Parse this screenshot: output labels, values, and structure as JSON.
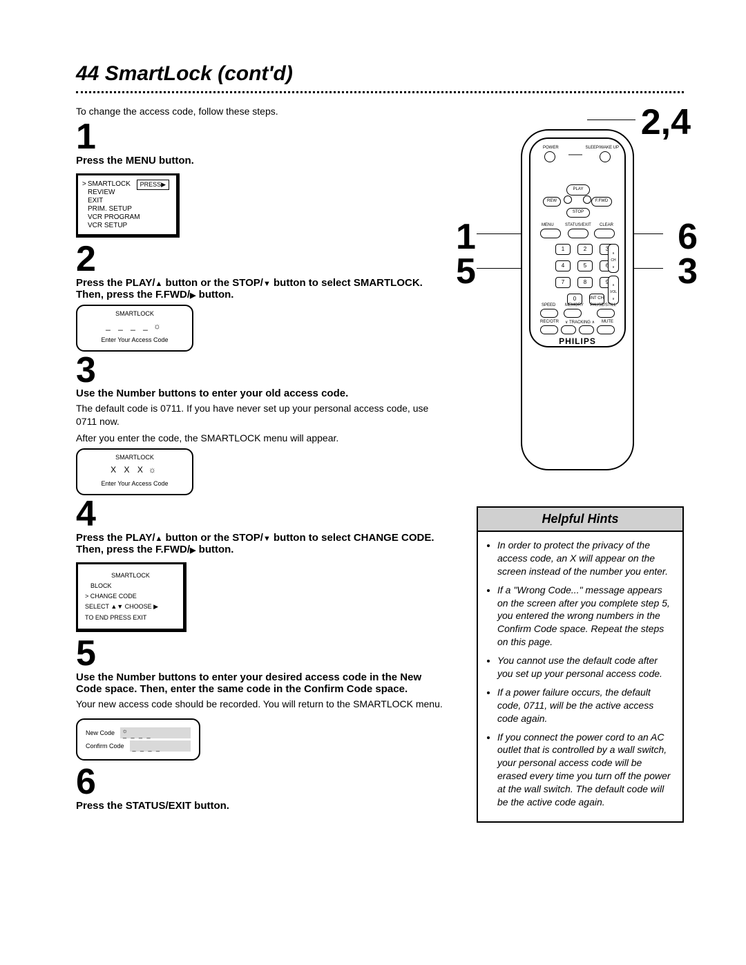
{
  "page": {
    "number": "44",
    "title": "SmartLock (cont'd)"
  },
  "intro": "To change the access code, follow these steps.",
  "steps": {
    "s1": {
      "num": "1",
      "bold": "Press the MENU button.",
      "menu": {
        "l1": "SMARTLOCK",
        "l2": "REVIEW",
        "l3": "EXIT",
        "l4": "PRIM. SETUP",
        "l5": "VCR PROGRAM",
        "l6": "VCR SETUP",
        "press": "PRESS▶"
      }
    },
    "s2": {
      "num": "2",
      "bold_a": "Press the PLAY/",
      "bold_b": " button or the STOP/",
      "bold_c": " button to select SMARTLOCK. Then, press the F.FWD/",
      "bold_d": " button.",
      "tv": {
        "title": "SMARTLOCK",
        "enter": "Enter Your Access Code"
      }
    },
    "s3": {
      "num": "3",
      "bold": "Use the Number buttons to enter your old access code.",
      "body1": "The default code is 0711. If you have never set up your personal access code, use 0711 now.",
      "body2": "After you enter the code, the SMARTLOCK menu will appear.",
      "tv": {
        "title": "SMARTLOCK",
        "xrow": "X  X  X",
        "enter": "Enter Your Access Code"
      }
    },
    "s4": {
      "num": "4",
      "bold_a": "Press the PLAY/",
      "bold_b": " button or the STOP/",
      "bold_c": " button to select CHANGE CODE. Then, press the F.FWD/",
      "bold_d": " button.",
      "menu": {
        "title": "SMARTLOCK",
        "l1": "BLOCK",
        "l2": "> CHANGE CODE",
        "l3a": "SELECT ▲▼ CHOOSE ▶",
        "l3b": "TO END PRESS EXIT"
      }
    },
    "s5": {
      "num": "5",
      "bold": "Use the Number buttons to enter your desired access code in the New Code space. Then, enter the same code in the Confirm Code space.",
      "body": "Your new access code should be recorded. You will return to the SMARTLOCK menu.",
      "box": {
        "new": "New Code",
        "confirm": "Confirm Code"
      }
    },
    "s6": {
      "num": "6",
      "bold": "Press the STATUS/EXIT button."
    }
  },
  "callouts": {
    "r24": "2,4",
    "r1": "1",
    "r6": "6",
    "r5": "5",
    "r3": "3"
  },
  "remote": {
    "power": "POWER",
    "sleep": "SLEEP/WAKE UP",
    "play": "PLAY",
    "rew": "REW",
    "ffwd": "F.FWD",
    "stop": "STOP",
    "menu": "MENU",
    "status": "STATUS/EXIT",
    "clear": "CLEAR",
    "intch": "INT CH",
    "ch": "CH",
    "vol": "VOL",
    "speed": "SPEED",
    "memory": "MEMORY",
    "pause": "PAUSE/STILL",
    "recotr": "REC/OTR",
    "tracking": "TRACKING",
    "mute": "MUTE",
    "brand": "PHILIPS",
    "k1": "1",
    "k2": "2",
    "k3": "3",
    "k4": "4",
    "k5": "5",
    "k6": "6",
    "k7": "7",
    "k8": "8",
    "k9": "9",
    "k0": "0"
  },
  "hints": {
    "title": "Helpful Hints",
    "h1": "In order to protect the privacy of the access code, an X will appear on the screen instead of the number you enter.",
    "h2": "If a \"Wrong Code...\" message appears on the screen after you complete step 5, you entered the wrong numbers in the Confirm Code space. Repeat the steps on this page.",
    "h3": "You cannot use the default code after you set up your personal access code.",
    "h4": "If a power failure occurs, the default code, 0711, will be the active access code again.",
    "h5": "If you connect the power cord to an AC outlet that is controlled by a wall switch, your personal access code will be erased every time you turn off the power at the wall switch. The default code will be the active code again."
  }
}
